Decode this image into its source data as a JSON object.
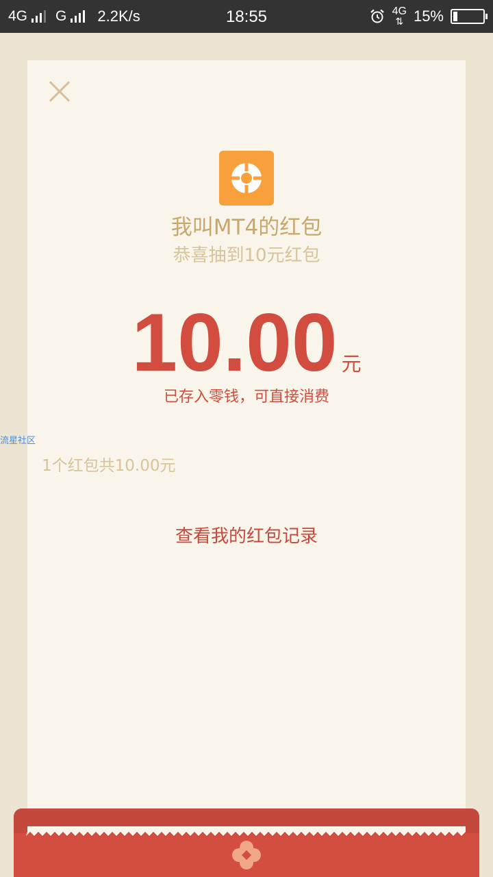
{
  "status_bar": {
    "network_left": "4G",
    "network_mid": "G",
    "speed": "2.2K/s",
    "time": "18:55",
    "data_label": "4G",
    "battery_percent": "15%",
    "battery_level": 0.15
  },
  "red_packet": {
    "sender": "我叫MT4的红包",
    "greeting": "恭喜抽到10元红包",
    "amount": "10.00",
    "unit": "元",
    "stored_note": "已存入零钱，可直接消费",
    "summary": "1个红包共10.00元",
    "records_link": "查看我的红包记录"
  },
  "watermark": "流星社区",
  "icons": {
    "close": "close-icon",
    "logo": "app-logo-icon",
    "envelope_emblem": "flower-icon",
    "alarm": "alarm-icon"
  },
  "colors": {
    "accent_red": "#d24c3f",
    "gold_text": "#c8a76c",
    "logo_orange": "#f7a03c",
    "card_bg": "#faf5ea",
    "page_bg": "#ede5d3"
  }
}
